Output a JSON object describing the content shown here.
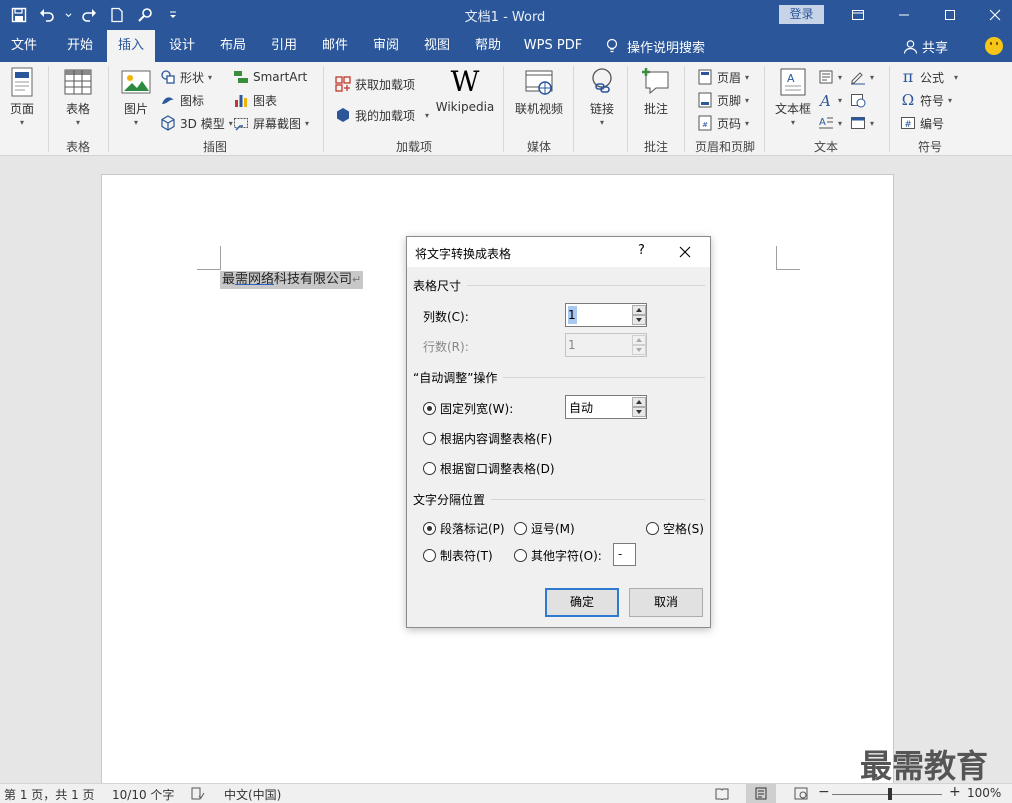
{
  "app": {
    "title": "文档1  -  Word",
    "login_label": "登录"
  },
  "tabs": [
    {
      "label": "文件"
    },
    {
      "label": "开始"
    },
    {
      "label": "插入"
    },
    {
      "label": "设计"
    },
    {
      "label": "布局"
    },
    {
      "label": "引用"
    },
    {
      "label": "邮件"
    },
    {
      "label": "审阅"
    },
    {
      "label": "视图"
    },
    {
      "label": "帮助"
    },
    {
      "label": "WPS PDF"
    }
  ],
  "active_tab": "插入",
  "tell_me": "操作说明搜索",
  "share": "共享",
  "ribbon": {
    "page": "页面",
    "table": "表格",
    "picture": "图片",
    "shapes": "形状",
    "icons": "图标",
    "model3d": "3D 模型",
    "smartart": "SmartArt",
    "chart": "图表",
    "screenshot": "屏幕截图",
    "get_addins": "获取加载项",
    "my_addins": "我的加载项",
    "wikipedia": "Wikipedia",
    "online_video": "联机视频",
    "link": "链接",
    "comment": "批注",
    "header": "页眉",
    "footer": "页脚",
    "page_number": "页码",
    "textbox": "文本框",
    "equation": "公式",
    "symbol": "符号",
    "numbering": "编号",
    "groups": {
      "table": "表格",
      "illustrations": "插图",
      "addins": "加载项",
      "media": "媒体",
      "comments": "批注",
      "header_footer": "页眉和页脚",
      "text": "文本",
      "symbols": "符号"
    }
  },
  "document": {
    "text_a": "最",
    "text_b": "需网络",
    "text_c": "科技有限公司",
    "para_mark": "↵"
  },
  "dialog": {
    "title": "将文字转换成表格",
    "help": "?",
    "section_size": "表格尺寸",
    "columns_label": "列数(C):",
    "columns_value": "1",
    "rows_label": "行数(R):",
    "rows_value": "1",
    "section_autofit": "“自动调整”操作",
    "fixed_width_label": "固定列宽(W):",
    "fixed_width_value": "自动",
    "autofit_content": "根据内容调整表格(F)",
    "autofit_window": "根据窗口调整表格(D)",
    "section_separator": "文字分隔位置",
    "sep_paragraph": "段落标记(P)",
    "sep_comma": "逗号(M)",
    "sep_space": "空格(S)",
    "sep_tab": "制表符(T)",
    "sep_other": "其他字符(O):",
    "other_char": "-",
    "ok": "确定",
    "cancel": "取消"
  },
  "status": {
    "page": "第 1 页，共 1 页",
    "words": "10/10 个字",
    "language": "中文(中国)",
    "zoom": "100%"
  },
  "watermark": "最需教育",
  "colors": {
    "titlebar": "#2b579a",
    "ribbon": "#f3f3f3",
    "selection": "#c8c8c8",
    "primary_button_border": "#2e7ad1"
  }
}
